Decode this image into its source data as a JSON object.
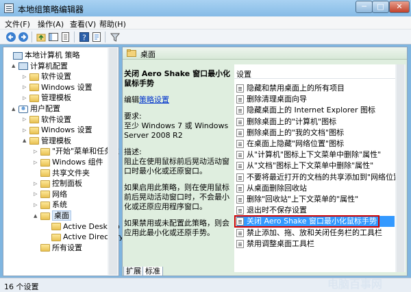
{
  "window": {
    "title": "本地组策略编辑器",
    "min": "─",
    "max": "□",
    "close": "✕"
  },
  "menu": [
    "文件(F)",
    "操作(A)",
    "查看(V)",
    "帮助(H)"
  ],
  "toolbar": [
    "back-icon",
    "forward-icon",
    "up-icon",
    "show-hide-tree-icon",
    "export-icon",
    "help-icon",
    "properties-icon",
    "filter-icon"
  ],
  "tree": [
    {
      "label": "本地计算机 策略",
      "icon": "policy",
      "level": 0,
      "expander": ""
    },
    {
      "label": "计算机配置",
      "icon": "computer",
      "level": 1,
      "expander": "▲"
    },
    {
      "label": "软件设置",
      "icon": "folder",
      "level": 2,
      "expander": "▷"
    },
    {
      "label": "Windows 设置",
      "icon": "folder",
      "level": 2,
      "expander": "▷"
    },
    {
      "label": "管理模板",
      "icon": "folder",
      "level": 2,
      "expander": "▷"
    },
    {
      "label": "用户配置",
      "icon": "user",
      "level": 1,
      "expander": "▲"
    },
    {
      "label": "软件设置",
      "icon": "folder",
      "level": 2,
      "expander": "▷"
    },
    {
      "label": "Windows 设置",
      "icon": "folder",
      "level": 2,
      "expander": "▷"
    },
    {
      "label": "管理模板",
      "icon": "folder",
      "level": 2,
      "expander": "▲"
    },
    {
      "label": "\"开始\"菜单和任务栏",
      "icon": "folder",
      "level": 3,
      "expander": "▷"
    },
    {
      "label": "Windows 组件",
      "icon": "folder",
      "level": 3,
      "expander": "▷"
    },
    {
      "label": "共享文件夹",
      "icon": "folder",
      "level": 3,
      "expander": ""
    },
    {
      "label": "控制面板",
      "icon": "folder",
      "level": 3,
      "expander": "▷"
    },
    {
      "label": "网络",
      "icon": "folder",
      "level": 3,
      "expander": "▷"
    },
    {
      "label": "系统",
      "icon": "folder",
      "level": 3,
      "expander": "▷"
    },
    {
      "label": "桌面",
      "icon": "folder",
      "level": 3,
      "expander": "▲",
      "selected": true
    },
    {
      "label": "Active Desktop",
      "icon": "folder",
      "level": 4,
      "expander": ""
    },
    {
      "label": "Active Directory",
      "icon": "folder",
      "level": 4,
      "expander": ""
    },
    {
      "label": "所有设置",
      "icon": "folder",
      "level": 3,
      "expander": ""
    }
  ],
  "header": {
    "title": "桌面"
  },
  "description": {
    "title": "关闭 Aero Shake 窗口最小化鼠标手势",
    "edit_prefix": "编辑",
    "edit_link": "策略设置",
    "requirements_label": "要求:",
    "requirements_text": "至少 Windows 7 或 Windows Server 2008 R2",
    "description_label": "描述:",
    "description_text": "阻止在使用鼠标前后晃动活动窗口时最小化或还原窗口。",
    "enabled_text": "如果启用此策略，则在使用鼠标前后晃动活动窗口时，不会最小化或还原应用程序窗口。",
    "disabled_text": "如果禁用或未配置此策略，则会应用此最小化或还原手势。"
  },
  "settings": {
    "column_header": "设置",
    "items": [
      "隐藏和禁用桌面上的所有项目",
      "删除清理桌面向导",
      "隐藏桌面上的 Internet Explorer 图标",
      "删除桌面上的\"计算机\"图标",
      "删除桌面上的\"我的文档\"图标",
      "在桌面上隐藏\"网络位置\"图标",
      "从\"计算机\"图标上下文菜单中删除\"属性\"",
      "从\"文档\"图标上下文菜单中删除\"属性\"",
      "不要将最近打开的文档的共享添加到\"网络位置\"",
      "从桌面删除回收站",
      "删除\"回收站\"上下文菜单的\"属性\"",
      "退出时不保存设置",
      "关闭 Aero Shake 窗口最小化鼠标手势",
      "禁止添加、拖、放和关闭任务栏的工具栏",
      "禁用调整桌面工具栏"
    ],
    "selected_index": 12
  },
  "tabs": [
    "扩展",
    "标准"
  ],
  "status": {
    "text": "16 个设置"
  },
  "watermark": "电脑百事网"
}
